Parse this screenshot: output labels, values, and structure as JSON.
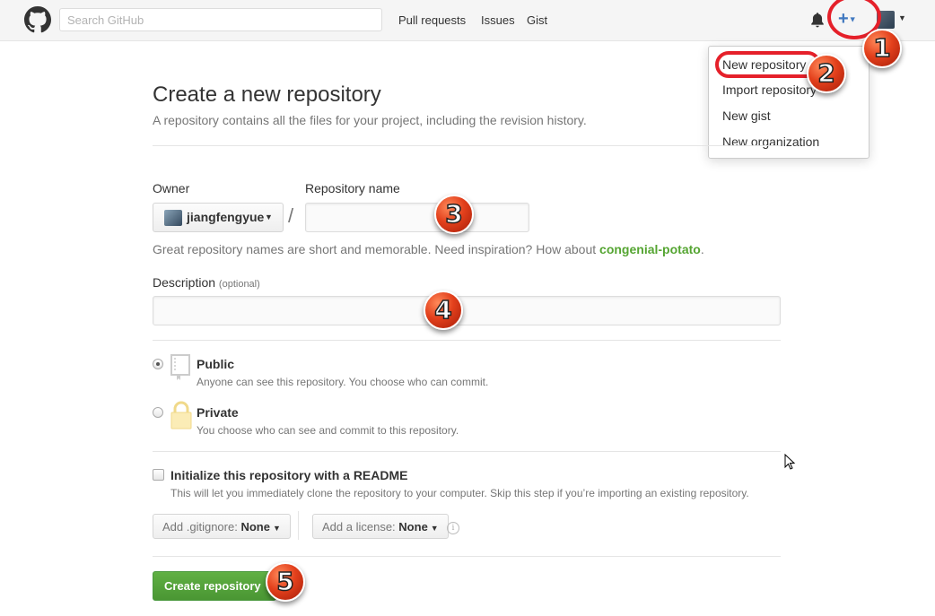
{
  "header": {
    "search_placeholder": "Search GitHub",
    "nav": [
      "Pull requests",
      "Issues",
      "Gist"
    ],
    "plus_label": "+",
    "icons": {
      "logo": "github-octocat-icon",
      "bell": "bell-icon",
      "plus": "plus-icon"
    }
  },
  "dropdown": {
    "items": [
      "New repository",
      "Import repository",
      "New gist",
      "New organization"
    ]
  },
  "annotations": [
    "1",
    "2",
    "3",
    "4",
    "5"
  ],
  "main": {
    "title": "Create a new repository",
    "subtitle": "A repository contains all the files for your project, including the revision history.",
    "owner_label": "Owner",
    "owner_name": "jiangfengyue",
    "separator": "/",
    "repo_name_label": "Repository name",
    "repo_name_value": "",
    "hint_prefix": "Great repository names are short and memorable. Need inspiration? How about ",
    "hint_suggestion": "congenial-potato",
    "hint_suffix": ".",
    "description_label": "Description",
    "description_optional": "(optional)",
    "description_value": "",
    "visibility": {
      "public_title": "Public",
      "public_desc": "Anyone can see this repository. You choose who can commit.",
      "private_title": "Private",
      "private_desc": "You choose who can see and commit to this repository.",
      "selected": "Public"
    },
    "readme": {
      "label": "Initialize this repository with a README",
      "desc": "This will let you immediately clone the repository to your computer. Skip this step if you’re importing an existing repository.",
      "checked": false
    },
    "gitignore_label": "Add .gitignore:",
    "gitignore_value": "None",
    "license_label": "Add a license:",
    "license_value": "None",
    "create_button": "Create repository"
  },
  "colors": {
    "accent_blue": "#4078c0",
    "annotation_red": "#e5202a",
    "primary_green": "#55a532",
    "suggestion_green": "#55a532"
  }
}
